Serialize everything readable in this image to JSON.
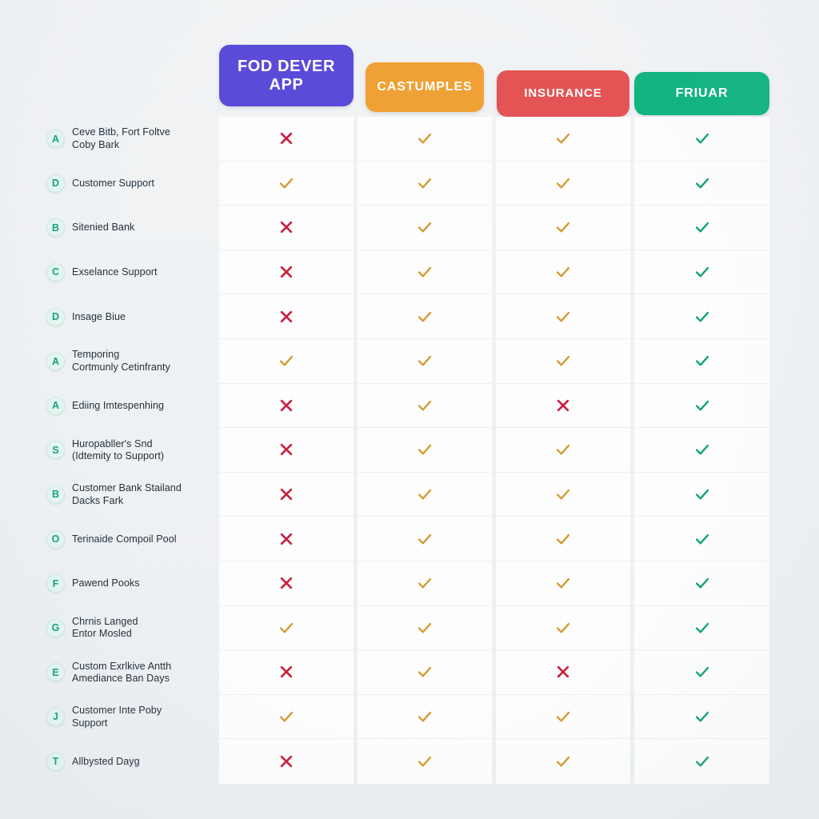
{
  "header": {
    "columns": [
      {
        "label": "FOD DEVER APP",
        "color": "#5a4bd8",
        "check_color": "#d49b34",
        "cross_color": "#c8203f"
      },
      {
        "label": "CASTUMPLES",
        "color": "#f0a135",
        "check_color": "#d49b34",
        "cross_color": "#c8203f"
      },
      {
        "label": "INSURANCE",
        "color": "#e45454",
        "check_color": "#d49b34",
        "cross_color": "#c8203f"
      },
      {
        "label": "FRIUAR",
        "color": "#12b481",
        "check_color": "#12a379",
        "cross_color": "#c8203f"
      }
    ]
  },
  "colors": {
    "page_background": "#eff2f4",
    "cell_background": "#fdfdfd",
    "row_divider": "#eceff1",
    "badge_fill": "#e4f6f1",
    "badge_text": "#17a07a",
    "label_text": "#22303c",
    "check_amber": "#d49b34",
    "check_teal": "#12a379",
    "cross_red": "#c8203f"
  },
  "rows": [
    {
      "badge": "A",
      "label": "Ceve Bitb, Fort Foltve\nCoby Bark",
      "values": [
        "cross",
        "check",
        "check",
        "check"
      ]
    },
    {
      "badge": "D",
      "label": "Customer Support",
      "values": [
        "check",
        "check",
        "check",
        "check"
      ]
    },
    {
      "badge": "B",
      "label": "Sitenied Bank",
      "values": [
        "cross",
        "check",
        "check",
        "check"
      ]
    },
    {
      "badge": "C",
      "label": "Exselance Support",
      "values": [
        "cross",
        "check",
        "check",
        "check"
      ]
    },
    {
      "badge": "D",
      "label": "Insage Biue",
      "values": [
        "cross",
        "check",
        "check",
        "check"
      ]
    },
    {
      "badge": "A",
      "label": "Temporing\nCortmunly Cetinfranty",
      "values": [
        "check",
        "check",
        "check",
        "check"
      ]
    },
    {
      "badge": "A",
      "label": "Ediing Imtespenhing",
      "values": [
        "cross",
        "check",
        "cross",
        "check"
      ]
    },
    {
      "badge": "S",
      "label": "Huropabller's Snd\n(Idtemity to Support)",
      "values": [
        "cross",
        "check",
        "check",
        "check"
      ]
    },
    {
      "badge": "B",
      "label": "Customer Bank Stailand\nDacks Fark",
      "values": [
        "cross",
        "check",
        "check",
        "check"
      ]
    },
    {
      "badge": "O",
      "label": "Terinaide Compoil Pool",
      "values": [
        "cross",
        "check",
        "check",
        "check"
      ]
    },
    {
      "badge": "F",
      "label": "Pawend Pooks",
      "values": [
        "cross",
        "check",
        "check",
        "check"
      ]
    },
    {
      "badge": "G",
      "label": "Chrnis Langed\nEntor Mosled",
      "values": [
        "check",
        "check",
        "check",
        "check"
      ]
    },
    {
      "badge": "E",
      "label": "Custom Exrlkive Antth\nAmediance Ban Days",
      "values": [
        "cross",
        "check",
        "cross",
        "check"
      ]
    },
    {
      "badge": "J",
      "label": "Customer Inte Poby\nSupport",
      "values": [
        "check",
        "check",
        "check",
        "check"
      ]
    },
    {
      "badge": "T",
      "label": "Allbysted Dayg",
      "values": [
        "cross",
        "check",
        "check",
        "check"
      ]
    }
  ],
  "icons": {
    "check": "check-icon",
    "cross": "cross-icon"
  }
}
